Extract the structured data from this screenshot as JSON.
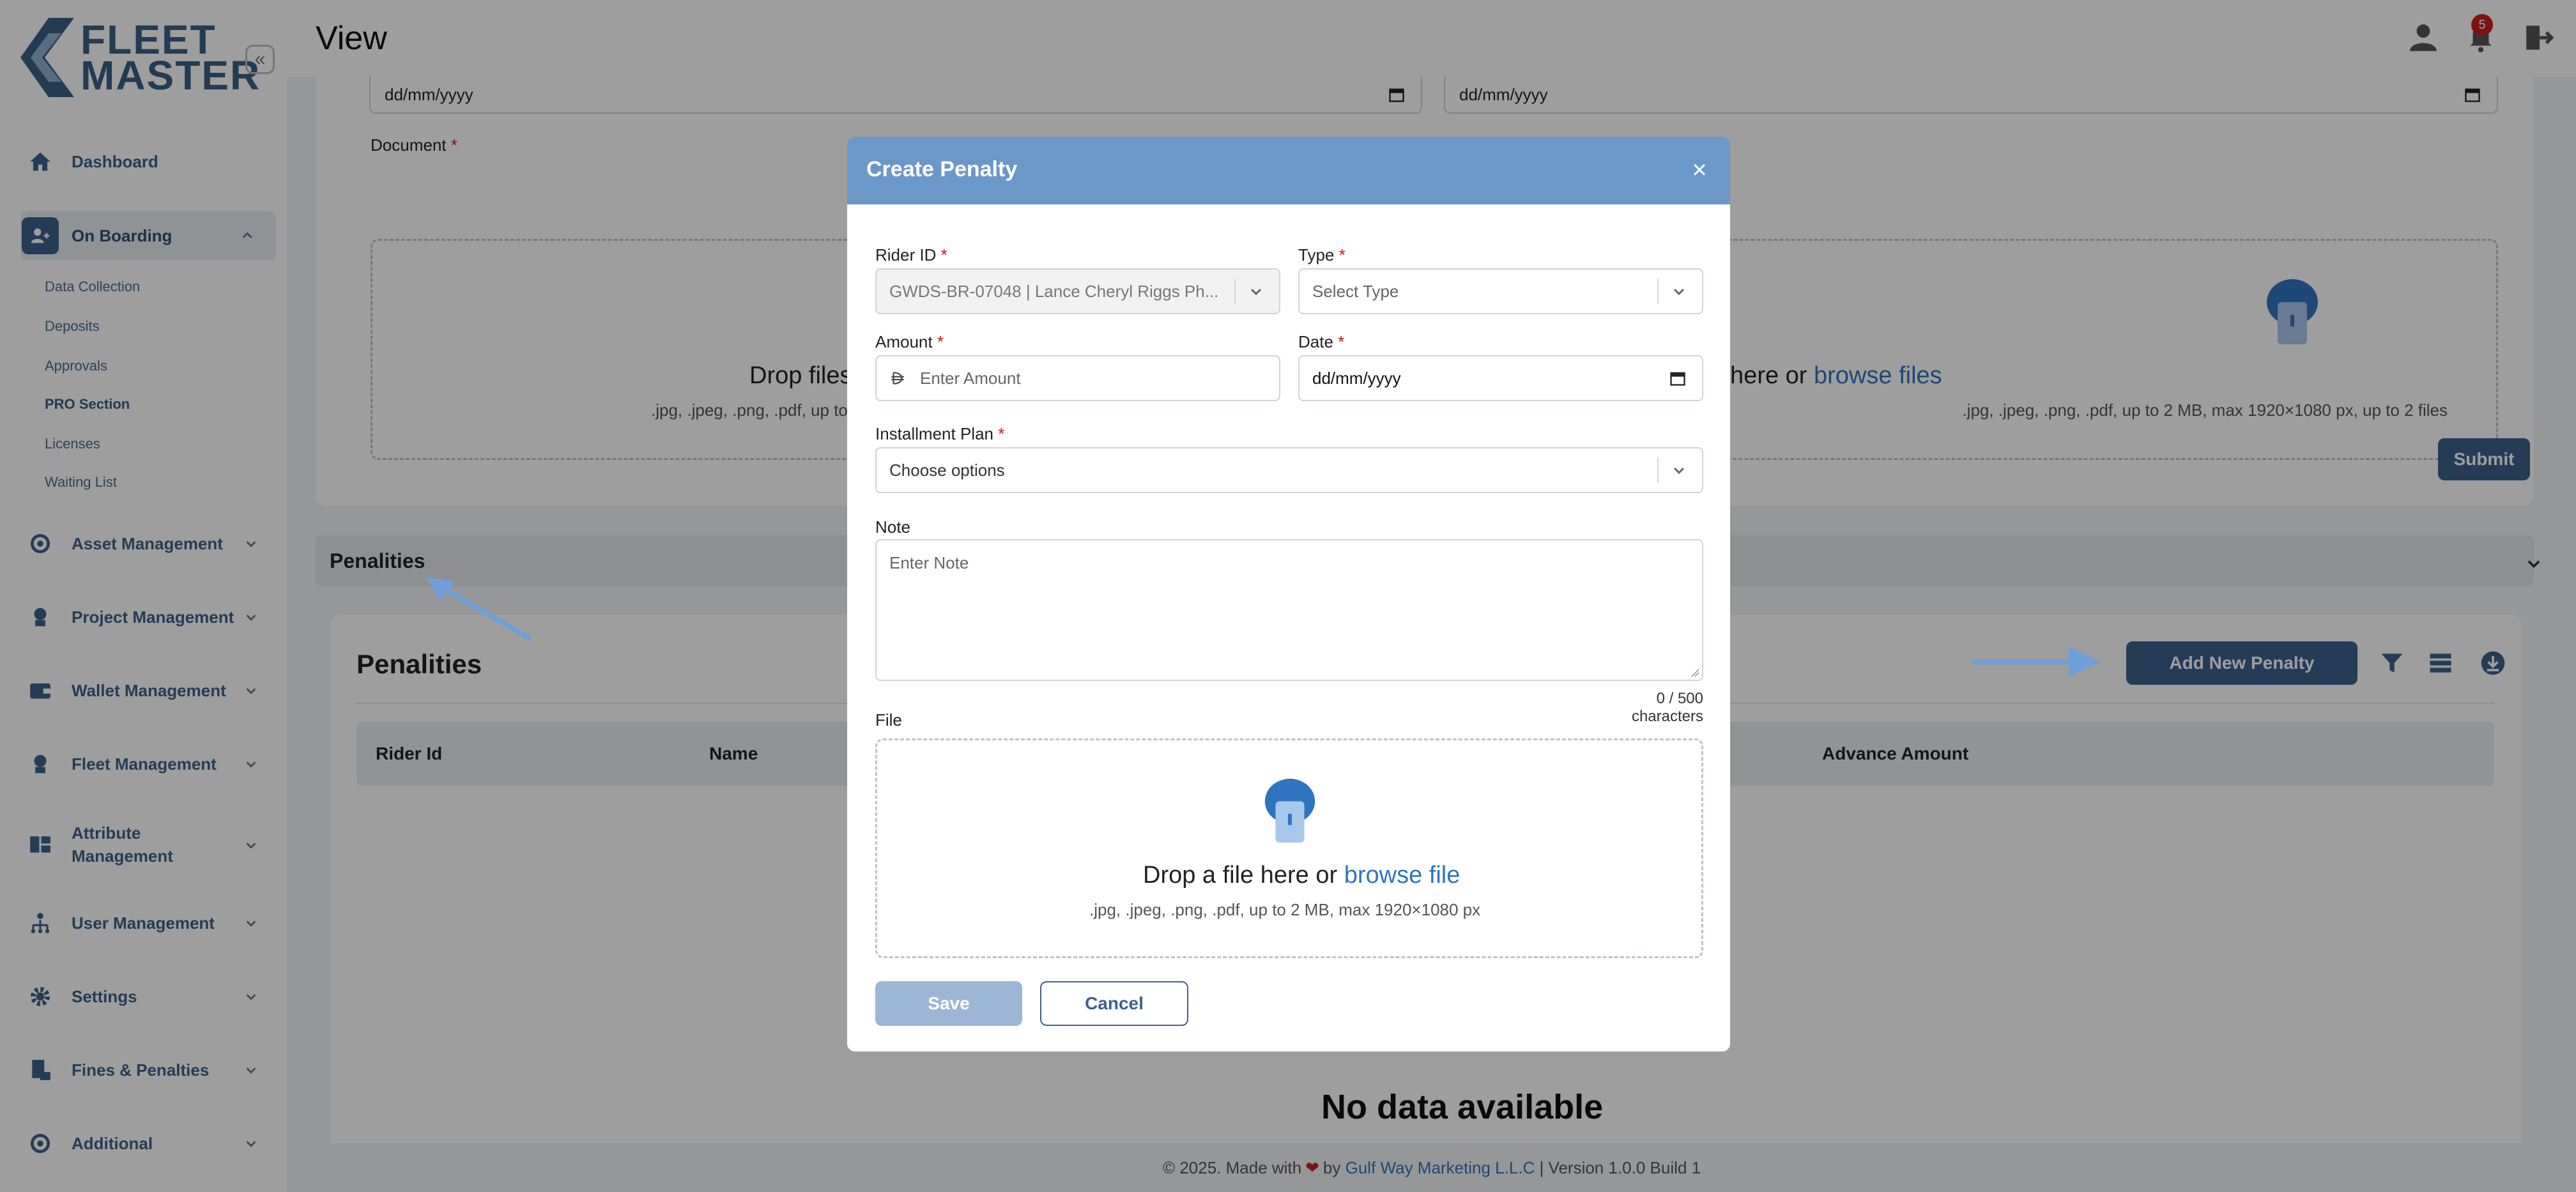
{
  "app": {
    "logo_text_line1": "FLEET",
    "logo_text_line2": "MASTER"
  },
  "header": {
    "page_title": "View",
    "notification_count": "5"
  },
  "sidebar": {
    "collapse_icon": "«",
    "items": [
      {
        "label": "Dashboard",
        "icon": "home-icon"
      },
      {
        "label": "On Boarding",
        "icon": "onboarding-icon",
        "active": true
      },
      {
        "label": "Asset Management",
        "icon": "asset-icon"
      },
      {
        "label": "Project Management",
        "icon": "project-icon"
      },
      {
        "label": "Wallet Management",
        "icon": "wallet-icon"
      },
      {
        "label": "Fleet Management",
        "icon": "fleet-icon"
      },
      {
        "label": "Attribute Management",
        "icon": "attribute-icon"
      },
      {
        "label": "User Management",
        "icon": "users-icon"
      },
      {
        "label": "Settings",
        "icon": "gear-icon"
      },
      {
        "label": "Fines & Penalties",
        "icon": "fines-icon"
      },
      {
        "label": "Additional",
        "icon": "additional-icon"
      }
    ],
    "sub_items": [
      "Data Collection",
      "Deposits",
      "Approvals",
      "PRO Section",
      "Licenses",
      "Waiting List"
    ],
    "active_sub_item": "PRO Section"
  },
  "form": {
    "date_placeholder": "dd/mm/yyyy",
    "document_label": "Document",
    "dropzone_text": "Drop files here or",
    "dropzone_text_left": "Drop files",
    "dropzone_link": "browse files",
    "dropzone_hint": ".jpg, .jpeg, .png, .pdf, up to 2 MB, max 1920×1080 px, up to 2 files",
    "dropzone_hint_left": ".jpg, .jpeg, .png, .pdf, up to",
    "dropzone_hint_right": ".jpg, .jpeg, .png, .pdf, up to 2 MB, max 1920×1080 px, up to 2 files",
    "submit_label": "Submit"
  },
  "penalties_section": {
    "bar_title": "Penalities",
    "card_title": "Penalities",
    "add_button": "Add New Penalty",
    "columns": [
      "Rider Id",
      "Name",
      "Advance Amount"
    ],
    "empty_text": "No data available"
  },
  "footer": {
    "prefix": "© 2025. Made with",
    "by": "by",
    "company": "Gulf Way Marketing L.L.C",
    "version": "| Version 1.0.0 Build 1"
  },
  "modal": {
    "title": "Create Penalty",
    "rider_id_label": "Rider ID",
    "rider_id_value": "GWDS-BR-07048 | Lance Cheryl Riggs Ph...",
    "type_label": "Type",
    "type_placeholder": "Select Type",
    "amount_label": "Amount",
    "amount_placeholder": "Enter Amount",
    "date_label": "Date",
    "date_placeholder": "dd/mm/yyyy",
    "installment_label": "Installment Plan",
    "installment_placeholder": "Choose options",
    "note_label": "Note",
    "note_placeholder": "Enter Note",
    "char_count": "0 / 500 characters",
    "file_label": "File",
    "file_drop_text": "Drop a file here or",
    "file_drop_link": "browse file",
    "file_hint": ".jpg, .jpeg, .png, .pdf, up to 2 MB, max 1920×1080 px",
    "save_label": "Save",
    "cancel_label": "Cancel"
  },
  "colors": {
    "brand": "#3d618b",
    "modal_header": "#6c97c9",
    "link": "#2f74c0",
    "required": "#dd1111",
    "arrow": "#6f9fd8"
  }
}
